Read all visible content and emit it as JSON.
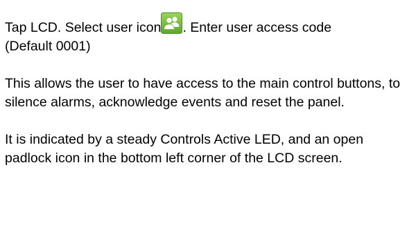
{
  "instructions": {
    "step_before_icon": "Tap LCD. Select user icon",
    "icon_name": "user-group-icon",
    "icon_color": "#7cc242",
    "step_after_icon": ". Enter user access code",
    "step_second_line": "(Default 0001)"
  },
  "access_description": {
    "text": "This allows the user to have access to the main control buttons, to silence alarms, acknowledge events and reset the panel."
  },
  "indicator_description": {
    "text": "It is indicated by a steady Controls Active LED, and an open padlock icon in the bottom left corner of the LCD screen."
  }
}
